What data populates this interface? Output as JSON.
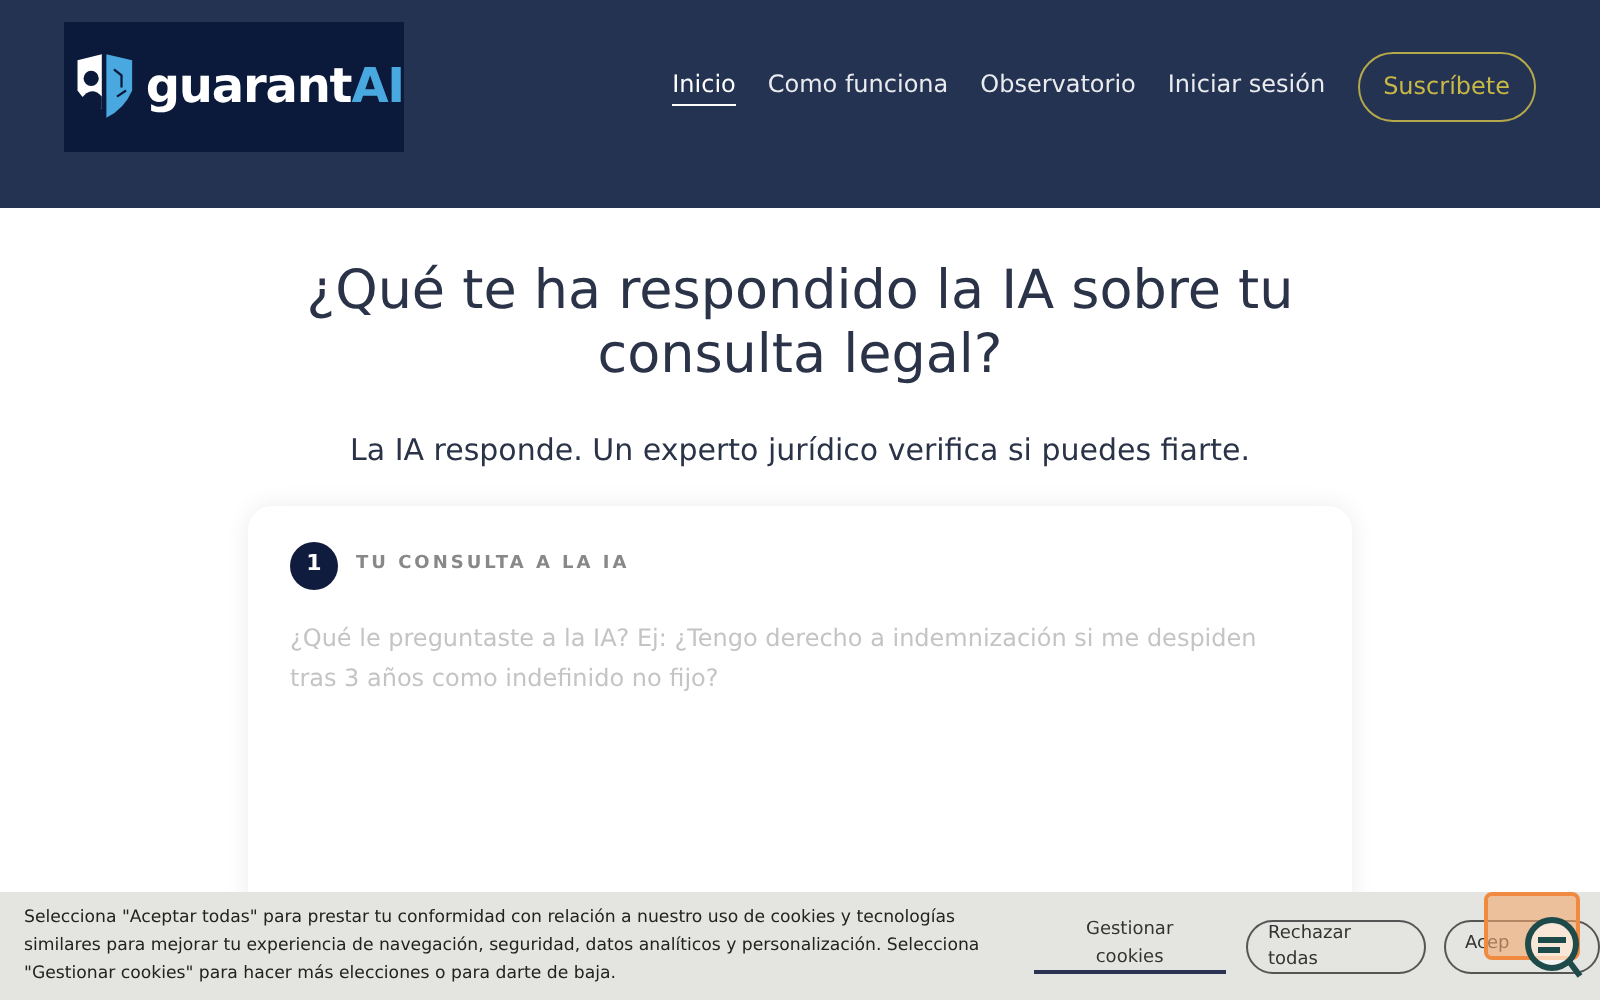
{
  "header": {
    "logo": {
      "parts": [
        "guarant",
        "AI"
      ]
    },
    "nav": [
      {
        "label": "Inicio",
        "selected": true
      },
      {
        "label": "Como funciona",
        "selected": false
      },
      {
        "label": "Observatorio",
        "selected": false
      },
      {
        "label": "Iniciar sesión",
        "selected": false
      }
    ],
    "cta": "Suscríbete"
  },
  "hero": {
    "title": "¿Qué te ha respondido la IA sobre tu consulta legal?",
    "subtitle": "La IA responde. Un experto jurídico verifica si puedes fiarte."
  },
  "card": {
    "step": "1",
    "step_label": "TU CONSULTA A LA IA",
    "placeholder": "¿Qué le preguntaste a la IA? Ej: ¿Tengo derecho a indemnización si me despiden tras 3 años como indefinido no fijo?"
  },
  "cookie_bar": {
    "text": "Selecciona \"Aceptar todas\" para prestar tu conformidad con relación a nuestro uso de cookies y tecnologías similares para mejorar tu experiencia de navegación, seguridad, datos analíticos y personalización. Selecciona \"Gestionar cookies\" para hacer más elecciones o para darte de baja.",
    "buttons": [
      {
        "kind": "link",
        "label": "Gestionar cookies"
      },
      {
        "kind": "outline",
        "label": "Rechazar todas"
      },
      {
        "kind": "outline",
        "label": "Acep"
      }
    ]
  }
}
